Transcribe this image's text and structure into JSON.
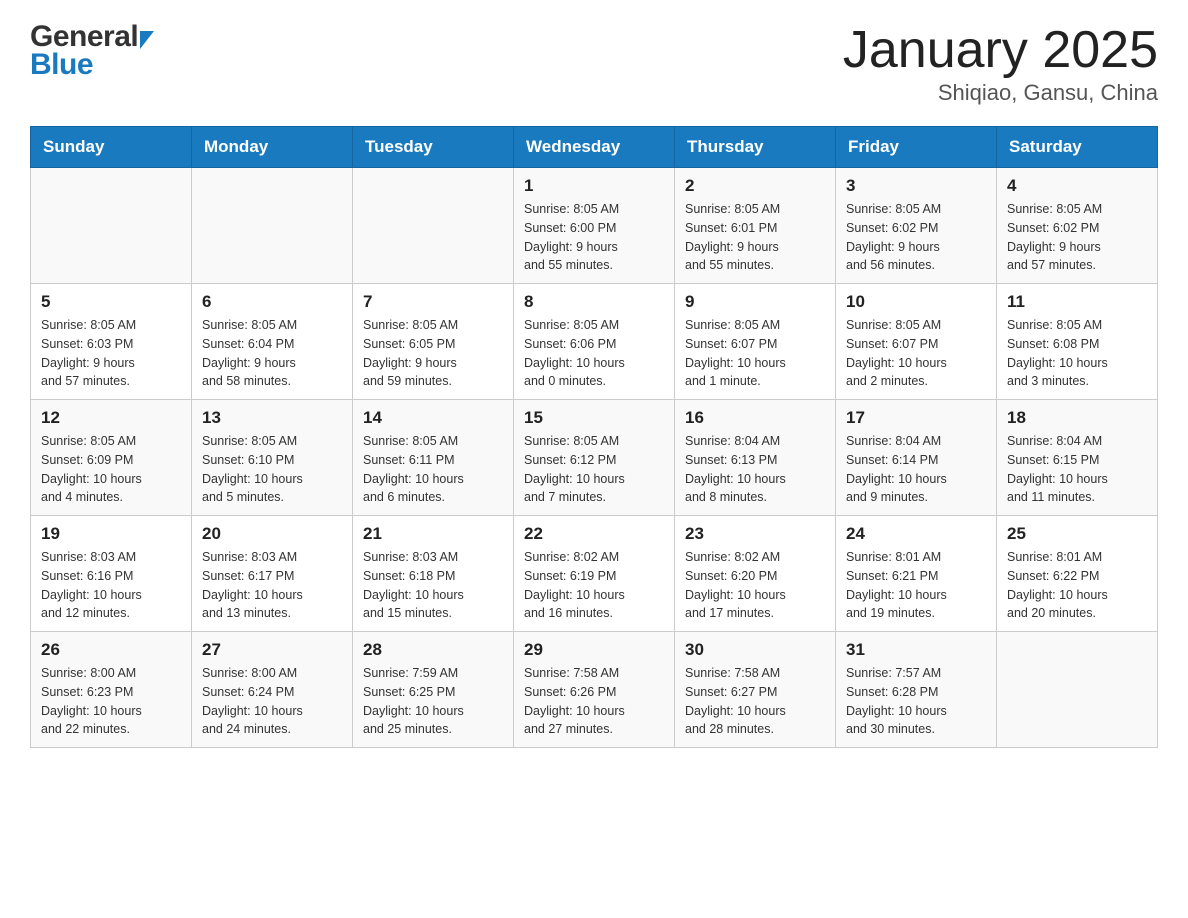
{
  "header": {
    "logo_general": "General",
    "logo_blue": "Blue",
    "title": "January 2025",
    "subtitle": "Shiqiao, Gansu, China"
  },
  "days_of_week": [
    "Sunday",
    "Monday",
    "Tuesday",
    "Wednesday",
    "Thursday",
    "Friday",
    "Saturday"
  ],
  "weeks": [
    [
      {
        "day": "",
        "info": ""
      },
      {
        "day": "",
        "info": ""
      },
      {
        "day": "",
        "info": ""
      },
      {
        "day": "1",
        "info": "Sunrise: 8:05 AM\nSunset: 6:00 PM\nDaylight: 9 hours\nand 55 minutes."
      },
      {
        "day": "2",
        "info": "Sunrise: 8:05 AM\nSunset: 6:01 PM\nDaylight: 9 hours\nand 55 minutes."
      },
      {
        "day": "3",
        "info": "Sunrise: 8:05 AM\nSunset: 6:02 PM\nDaylight: 9 hours\nand 56 minutes."
      },
      {
        "day": "4",
        "info": "Sunrise: 8:05 AM\nSunset: 6:02 PM\nDaylight: 9 hours\nand 57 minutes."
      }
    ],
    [
      {
        "day": "5",
        "info": "Sunrise: 8:05 AM\nSunset: 6:03 PM\nDaylight: 9 hours\nand 57 minutes."
      },
      {
        "day": "6",
        "info": "Sunrise: 8:05 AM\nSunset: 6:04 PM\nDaylight: 9 hours\nand 58 minutes."
      },
      {
        "day": "7",
        "info": "Sunrise: 8:05 AM\nSunset: 6:05 PM\nDaylight: 9 hours\nand 59 minutes."
      },
      {
        "day": "8",
        "info": "Sunrise: 8:05 AM\nSunset: 6:06 PM\nDaylight: 10 hours\nand 0 minutes."
      },
      {
        "day": "9",
        "info": "Sunrise: 8:05 AM\nSunset: 6:07 PM\nDaylight: 10 hours\nand 1 minute."
      },
      {
        "day": "10",
        "info": "Sunrise: 8:05 AM\nSunset: 6:07 PM\nDaylight: 10 hours\nand 2 minutes."
      },
      {
        "day": "11",
        "info": "Sunrise: 8:05 AM\nSunset: 6:08 PM\nDaylight: 10 hours\nand 3 minutes."
      }
    ],
    [
      {
        "day": "12",
        "info": "Sunrise: 8:05 AM\nSunset: 6:09 PM\nDaylight: 10 hours\nand 4 minutes."
      },
      {
        "day": "13",
        "info": "Sunrise: 8:05 AM\nSunset: 6:10 PM\nDaylight: 10 hours\nand 5 minutes."
      },
      {
        "day": "14",
        "info": "Sunrise: 8:05 AM\nSunset: 6:11 PM\nDaylight: 10 hours\nand 6 minutes."
      },
      {
        "day": "15",
        "info": "Sunrise: 8:05 AM\nSunset: 6:12 PM\nDaylight: 10 hours\nand 7 minutes."
      },
      {
        "day": "16",
        "info": "Sunrise: 8:04 AM\nSunset: 6:13 PM\nDaylight: 10 hours\nand 8 minutes."
      },
      {
        "day": "17",
        "info": "Sunrise: 8:04 AM\nSunset: 6:14 PM\nDaylight: 10 hours\nand 9 minutes."
      },
      {
        "day": "18",
        "info": "Sunrise: 8:04 AM\nSunset: 6:15 PM\nDaylight: 10 hours\nand 11 minutes."
      }
    ],
    [
      {
        "day": "19",
        "info": "Sunrise: 8:03 AM\nSunset: 6:16 PM\nDaylight: 10 hours\nand 12 minutes."
      },
      {
        "day": "20",
        "info": "Sunrise: 8:03 AM\nSunset: 6:17 PM\nDaylight: 10 hours\nand 13 minutes."
      },
      {
        "day": "21",
        "info": "Sunrise: 8:03 AM\nSunset: 6:18 PM\nDaylight: 10 hours\nand 15 minutes."
      },
      {
        "day": "22",
        "info": "Sunrise: 8:02 AM\nSunset: 6:19 PM\nDaylight: 10 hours\nand 16 minutes."
      },
      {
        "day": "23",
        "info": "Sunrise: 8:02 AM\nSunset: 6:20 PM\nDaylight: 10 hours\nand 17 minutes."
      },
      {
        "day": "24",
        "info": "Sunrise: 8:01 AM\nSunset: 6:21 PM\nDaylight: 10 hours\nand 19 minutes."
      },
      {
        "day": "25",
        "info": "Sunrise: 8:01 AM\nSunset: 6:22 PM\nDaylight: 10 hours\nand 20 minutes."
      }
    ],
    [
      {
        "day": "26",
        "info": "Sunrise: 8:00 AM\nSunset: 6:23 PM\nDaylight: 10 hours\nand 22 minutes."
      },
      {
        "day": "27",
        "info": "Sunrise: 8:00 AM\nSunset: 6:24 PM\nDaylight: 10 hours\nand 24 minutes."
      },
      {
        "day": "28",
        "info": "Sunrise: 7:59 AM\nSunset: 6:25 PM\nDaylight: 10 hours\nand 25 minutes."
      },
      {
        "day": "29",
        "info": "Sunrise: 7:58 AM\nSunset: 6:26 PM\nDaylight: 10 hours\nand 27 minutes."
      },
      {
        "day": "30",
        "info": "Sunrise: 7:58 AM\nSunset: 6:27 PM\nDaylight: 10 hours\nand 28 minutes."
      },
      {
        "day": "31",
        "info": "Sunrise: 7:57 AM\nSunset: 6:28 PM\nDaylight: 10 hours\nand 30 minutes."
      },
      {
        "day": "",
        "info": ""
      }
    ]
  ]
}
